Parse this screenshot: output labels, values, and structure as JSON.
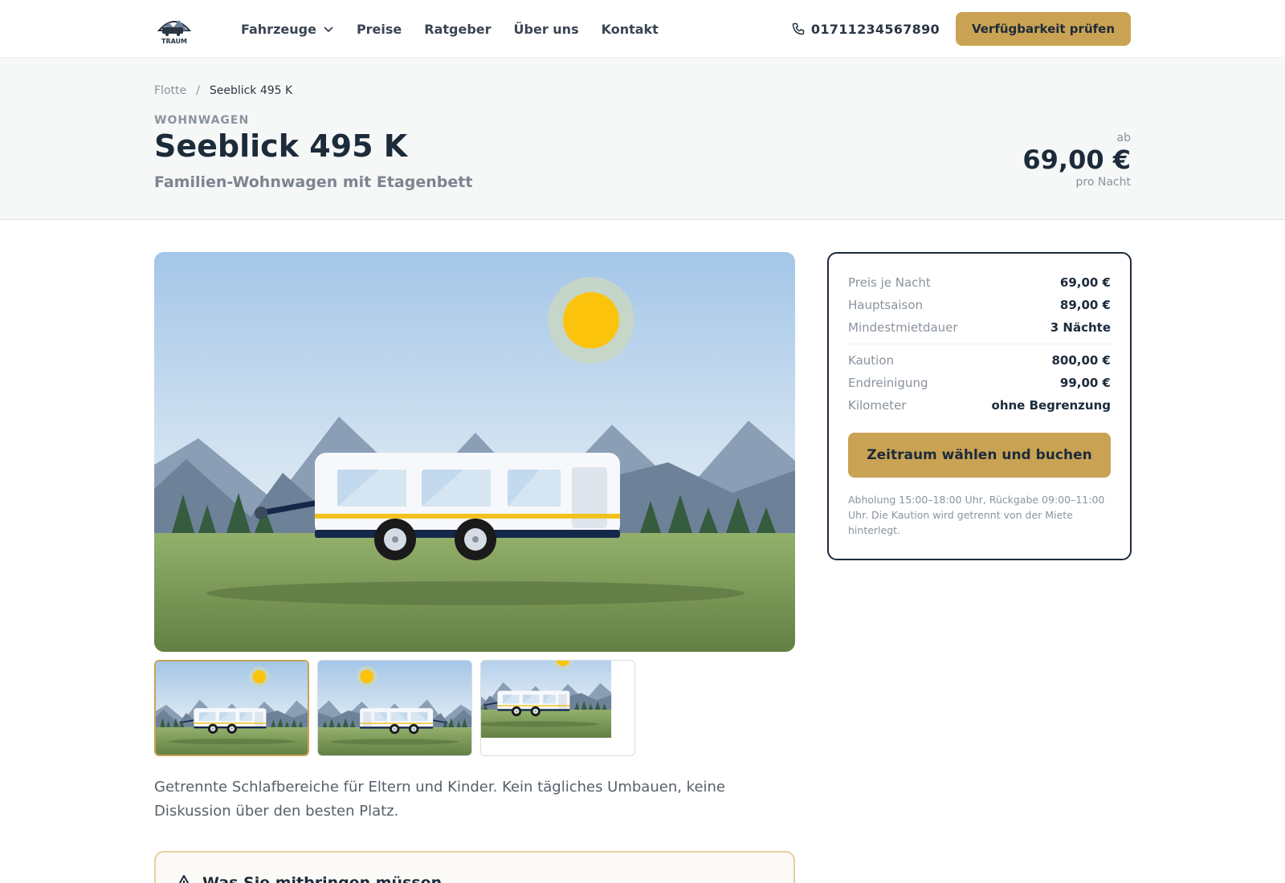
{
  "header": {
    "logo_text": "TRAUM",
    "nav": [
      {
        "label": "Fahrzeuge",
        "has_dropdown": true
      },
      {
        "label": "Preise"
      },
      {
        "label": "Ratgeber"
      },
      {
        "label": "Über uns"
      },
      {
        "label": "Kontakt"
      }
    ],
    "phone": "01711234567890",
    "cta": "Verfügbarkeit prüfen"
  },
  "hero": {
    "breadcrumb": {
      "parent": "Flotte",
      "separator": "/",
      "current": "Seeblick 495 K"
    },
    "category": "WOHNWAGEN",
    "title": "Seeblick 495 K",
    "subtitle": "Familien-Wohnwagen mit Etagenbett",
    "price": {
      "from": "ab",
      "amount": "69,00 €",
      "unit": "pro Nacht"
    }
  },
  "gallery": {
    "active_index": 0,
    "thumbnail_count": 3
  },
  "description": "Getrennte Schlafbereiche für Eltern und Kinder. Kein tägliches Umbauen, keine Diskussion über den besten Platz.",
  "notice": {
    "title": "Was Sie mitbringen müssen"
  },
  "booking": {
    "rows_group1": [
      {
        "label": "Preis je Nacht",
        "value": "69,00 €"
      },
      {
        "label": "Hauptsaison",
        "value": "89,00 €"
      },
      {
        "label": "Mindestmietdauer",
        "value": "3 Nächte"
      }
    ],
    "rows_group2": [
      {
        "label": "Kaution",
        "value": "800,00 €"
      },
      {
        "label": "Endreinigung",
        "value": "99,00 €"
      },
      {
        "label": "Kilometer",
        "value": "ohne Begrenzung"
      }
    ],
    "button": "Zeitraum wählen und buchen",
    "note": "Abholung 15:00–18:00 Uhr, Rückgabe 09:00–11:00 Uhr. Die Kaution wird getrennt von der Miete hinterlegt."
  },
  "colors": {
    "accent": "#c9a253",
    "navy": "#1c2b3a",
    "muted": "#8a939d"
  }
}
